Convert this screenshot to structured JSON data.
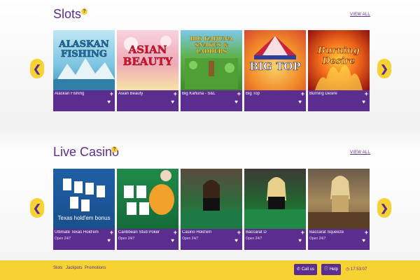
{
  "sections": {
    "slots": {
      "title": "Slots",
      "help": "?",
      "view_all": "VIEW ALL"
    },
    "live": {
      "title": "Live Casino",
      "help": "?",
      "view_all": "VIEW ALL"
    }
  },
  "nav": {
    "prev": "❮",
    "next": "❯"
  },
  "slots": [
    {
      "label": "Alaskan Fishing",
      "art": "ALASKAN FISHING"
    },
    {
      "label": "Asian Beauty",
      "art": "ASIAN BEAUTY"
    },
    {
      "label": "Big Kahuna - S&L",
      "art": "BIG KAHUNA SNAKES & LADDERS"
    },
    {
      "label": "Big Top",
      "art": "BIG TOP"
    },
    {
      "label": "Burning Desire",
      "art": "Burning Desire"
    }
  ],
  "live": [
    {
      "label": "Ultimate Texas Hold'em",
      "sub": "Open 24/7",
      "art": "Texas hold'em bonus"
    },
    {
      "label": "Caribbean Stud Poker",
      "sub": "Open 24/7",
      "art": ""
    },
    {
      "label": "Casino Hold'em",
      "sub": "Open 24/7",
      "art": ""
    },
    {
      "label": "Baccarat D",
      "sub": "Open 24/7",
      "art": ""
    },
    {
      "label": "Baccarat Squeeze",
      "sub": "Open 24/7",
      "art": ""
    }
  ],
  "card_icons": {
    "plus": "+",
    "heart": "♥"
  },
  "footer": {
    "links": [
      "Slots",
      "Jackpots",
      "Promotions"
    ],
    "call_us": "Call us",
    "help": "Help",
    "clock": "17:53:07"
  },
  "colors": {
    "brand_purple": "#5b2d8e",
    "brand_yellow": "#f6d332"
  }
}
